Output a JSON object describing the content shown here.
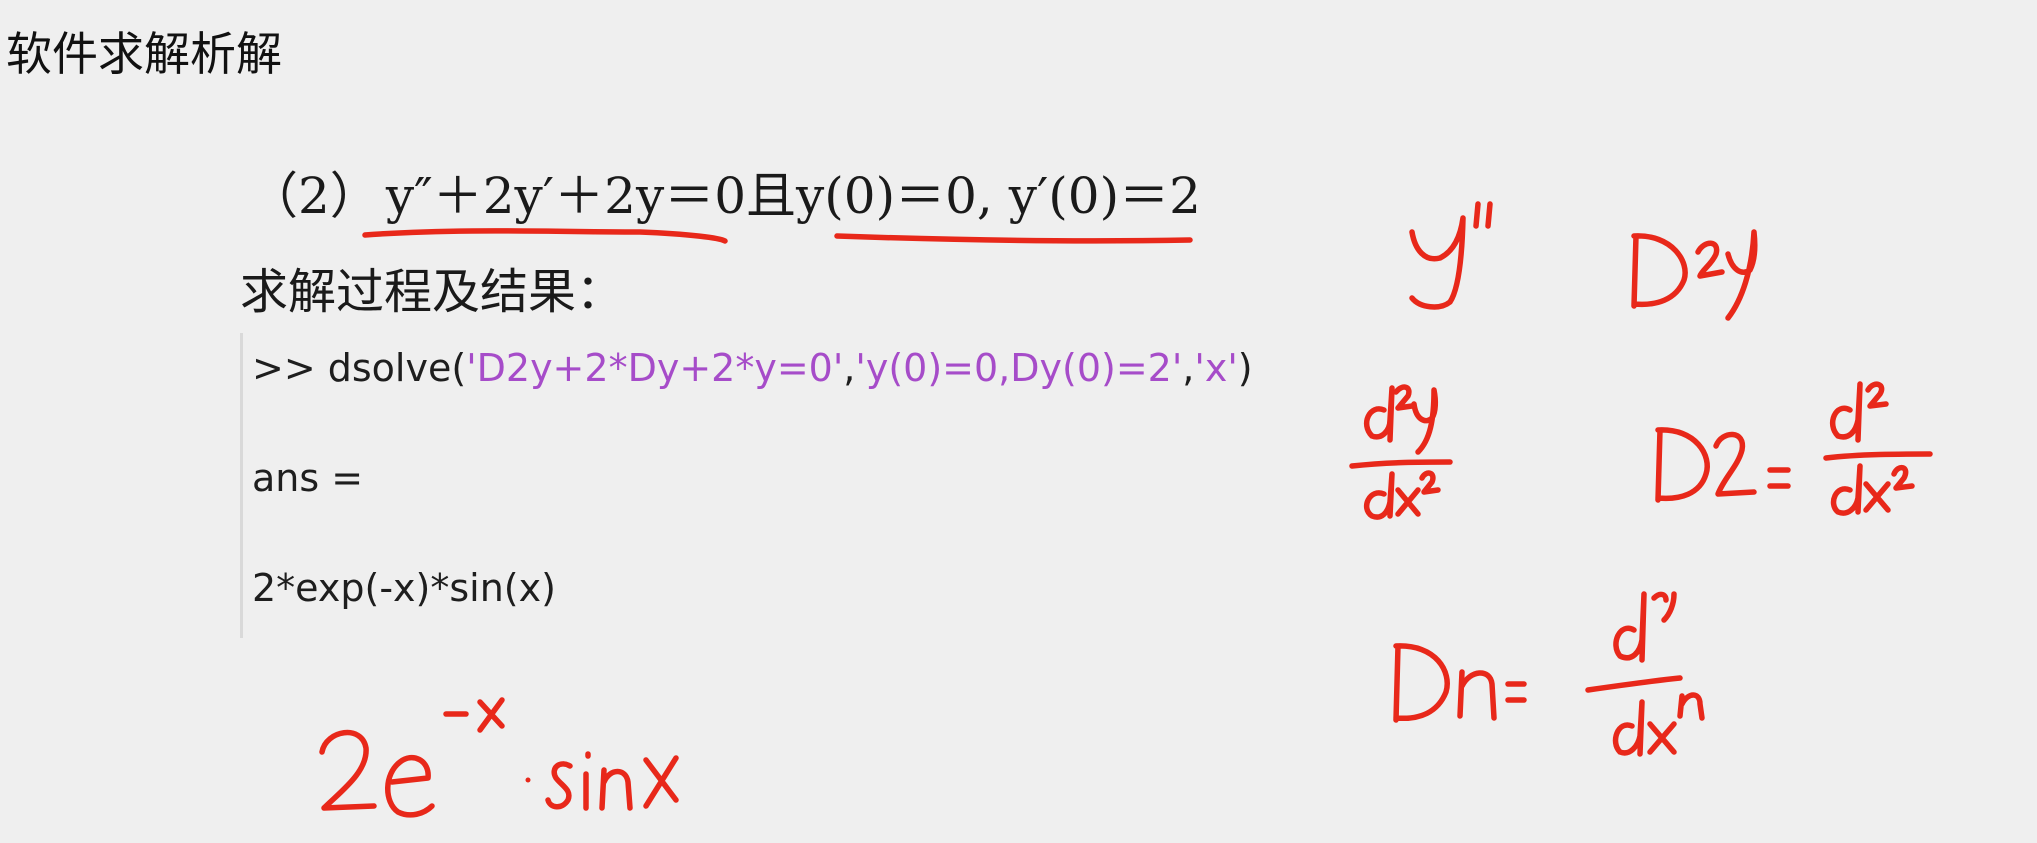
{
  "slide": {
    "title": "软件求解析解",
    "problem": {
      "number": "（2）",
      "equation": "y″＋2y′＋2y＝0",
      "conjunction": "且",
      "conditions": "y(0)＝0, y′(0)＝2"
    },
    "process_label": "求解过程及结果："
  },
  "console": {
    "prompt": ">> dsolve(",
    "arg1": "'D2y+2*Dy+2*y=0'",
    "sep1": ",",
    "arg2": "'y(0)=0,Dy(0)=2'",
    "sep2": ",",
    "arg3": "'x'",
    "close": ")",
    "ans_label": "ans =",
    "result": "2*exp(-x)*sin(x)"
  },
  "handwriting": {
    "ink_color": "#e8281a",
    "notes": [
      "y\"",
      "D²y",
      "d²y/dx²",
      "D2 = d²/dx²",
      "Dn = dⁿ/dxⁿ",
      "2e^(-x)·sinx"
    ]
  }
}
